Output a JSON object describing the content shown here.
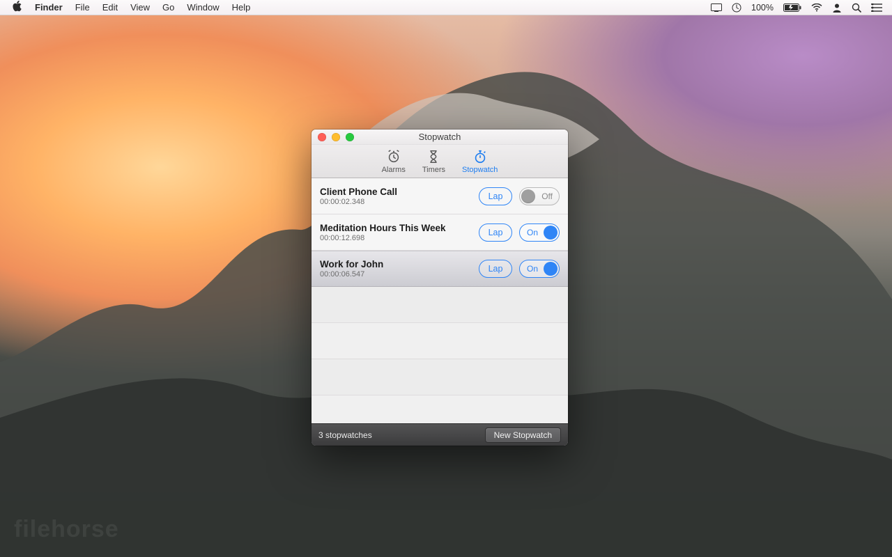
{
  "menubar": {
    "app": "Finder",
    "items": [
      "File",
      "Edit",
      "View",
      "Go",
      "Window",
      "Help"
    ],
    "battery": "100%"
  },
  "window": {
    "title": "Stopwatch",
    "tabs": {
      "alarms": "Alarms",
      "timers": "Timers",
      "stopwatch": "Stopwatch"
    },
    "active_tab": "stopwatch",
    "lap_label": "Lap",
    "on_label": "On",
    "off_label": "Off",
    "stopwatches": [
      {
        "label": "Client Phone Call",
        "time": "00:00:02.348",
        "running": false,
        "selected": false
      },
      {
        "label": "Meditation Hours This Week",
        "time": "00:00:12.698",
        "running": true,
        "selected": false
      },
      {
        "label": "Work for John",
        "time": "00:00:06.547",
        "running": true,
        "selected": true
      }
    ],
    "status_text": "3 stopwatches",
    "new_button": "New Stopwatch"
  },
  "watermark": "filehorse"
}
